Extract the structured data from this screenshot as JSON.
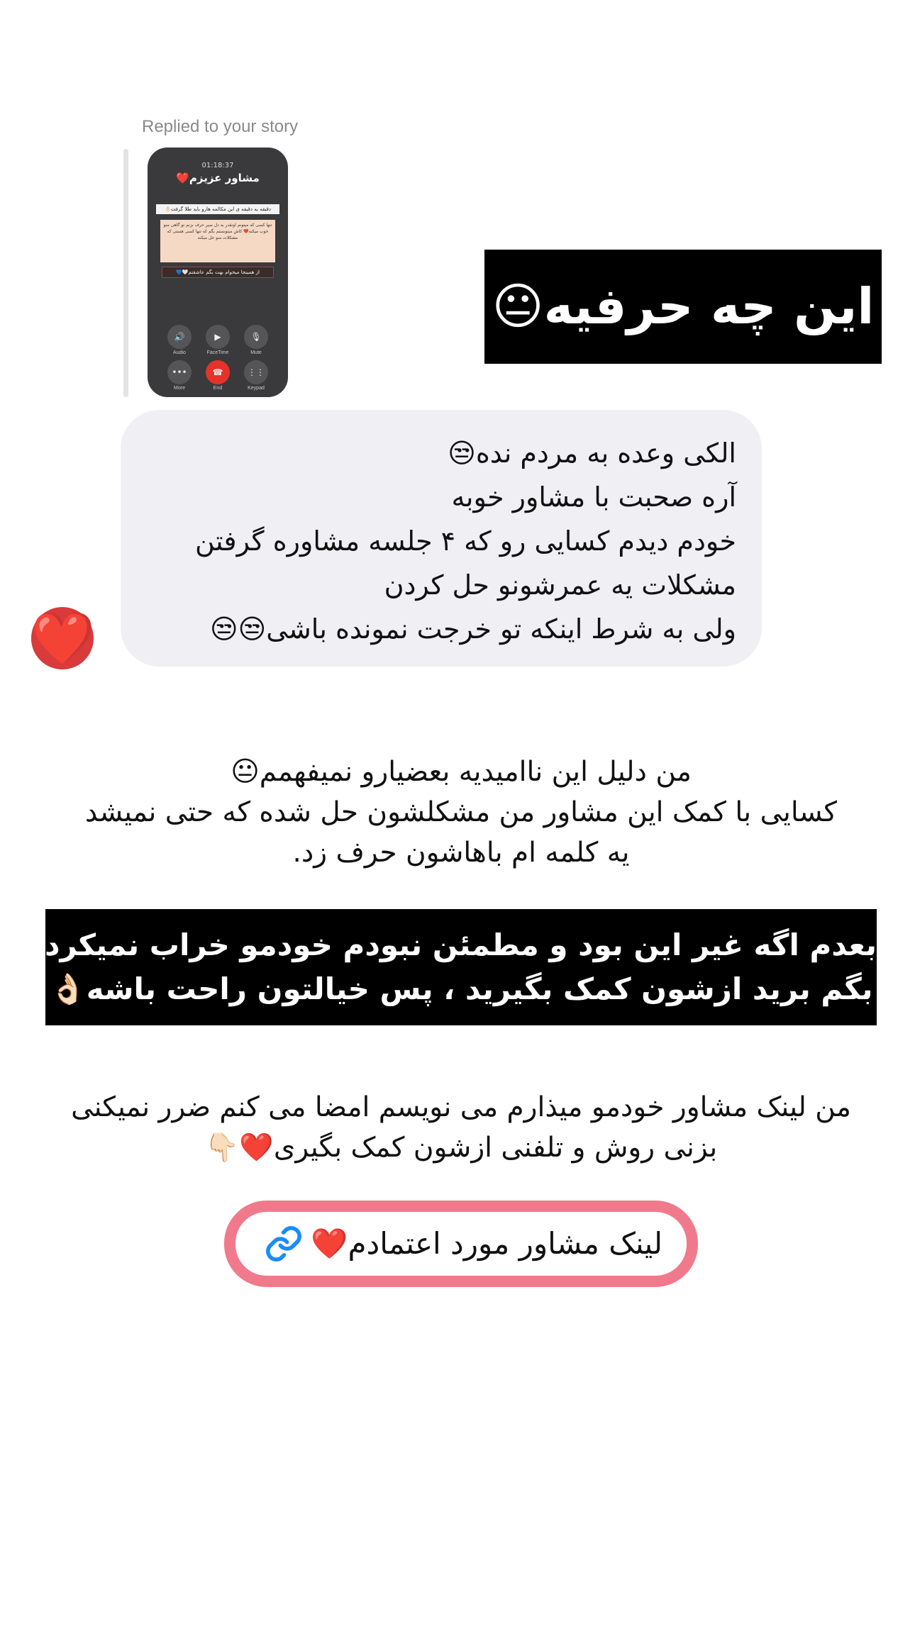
{
  "reply_header": "Replied to your story",
  "story": {
    "time": "01:18:37",
    "name": "مشاور عزیزم❤️",
    "line1": "دقیقه به دقیقه ی این مکالمه هارو باید طلا گرفت👌🏻",
    "note": "تنها کسی که میتونم اونقدر به دل سیر حرف بزنم تو گاهی منو خوب میکنه❤️ کاش میتونستم بگم که تنها کسی هستی که مشکلات منو حل میکنه",
    "line2": "از همینجا میخوام بهت بگم عاشقتم🤍💙",
    "buttons": [
      {
        "label": "Audio",
        "icon": "🔊"
      },
      {
        "label": "FaceTime",
        "icon": "▶"
      },
      {
        "label": "Mute",
        "icon": "🎙"
      },
      {
        "label": "More",
        "icon": "•••"
      },
      {
        "label": "End",
        "icon": "☎"
      },
      {
        "label": "Keypad",
        "icon": "⋮⋮"
      }
    ]
  },
  "title_caption": "این چه حرفیه😐",
  "bubble_lines": [
    "الکی وعده به مردم نده😒",
    "آره صحبت با مشاور خوبه",
    "خودم دیدم کسایی رو که ۴ جلسه مشاوره گرفتن",
    "مشکلات یه عمرشونو حل کردن",
    "ولی به شرط اینکه تو خرجت نمونده باشی😒😒"
  ],
  "reaction": "❤️",
  "paragraph1": [
    "من دلیل این ناامیدیه بعضیارو نمیفهمم😐",
    "کسایی با کمک این مشاور من مشکلشون حل شده که حتی نمیشد",
    "یه کلمه ام باهاشون حرف زد."
  ],
  "warning_box": [
    "بعدم اگه غیر این بود و مطمئن نبودم خودمو خراب نمیکردم",
    "بگم برید ازشون کمک بگیرید ، پس خیالتون راحت باشه👌🏻"
  ],
  "paragraph2": [
    "من لینک مشاور خودمو میذارم می نویسم امضا می کنم ضرر نمیکنی",
    "بزنی روش و تلفنی ازشون کمک بگیری❤️👇🏻"
  ],
  "link_sticker": {
    "label": "لینک مشاور مورد اعتمادم❤️",
    "icon": "link-icon",
    "border_color": "#f07a8c",
    "icon_color": "#1a8cff"
  }
}
